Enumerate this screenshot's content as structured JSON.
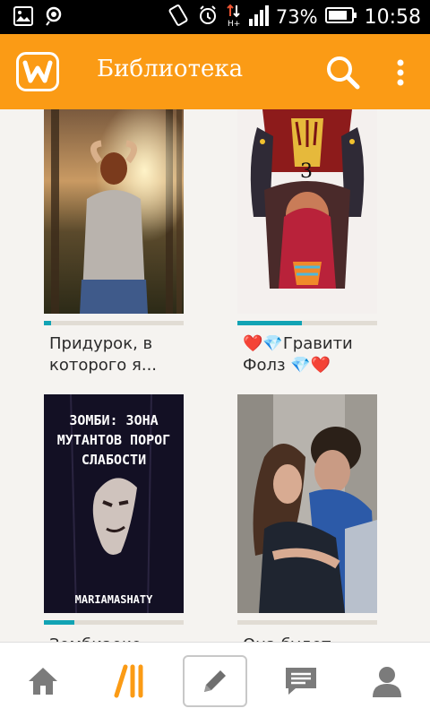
{
  "status_bar": {
    "left_icons": [
      "gallery-icon",
      "mic-icon"
    ],
    "right_icons": [
      "vibrate-icon",
      "alarm-icon",
      "data-arrows-icon",
      "signal-icon",
      "battery-icon"
    ],
    "battery_percent": "73%",
    "time": "10:58"
  },
  "app_bar": {
    "logo_icon": "wattpad-logo",
    "title": "Библиотека",
    "search_icon": "search-icon",
    "menu_icon": "more-vert-icon",
    "color": "#fb9b15"
  },
  "books": [
    {
      "title": "Придурок, в которого я...",
      "progress": 0.05
    },
    {
      "title": "❤️💎Гравити Фолз 💎❤️",
      "progress": 0.46
    },
    {
      "title": "Зомбиаоко...",
      "progress": 0.22,
      "cover_text": {
        "heading": "ЗОМБИ: ЗОНА МУТАНТОВ ПОРОГ СЛАБОСТИ",
        "author": "MARIAMASHATY"
      }
    },
    {
      "title": "Она будет...",
      "progress": 0.0
    }
  ],
  "bottom_nav": {
    "items": [
      "home-icon",
      "library-icon",
      "write-icon",
      "messages-icon",
      "profile-icon"
    ],
    "active": "library-icon"
  },
  "colors": {
    "accent": "#fb9b15",
    "progress": "#12a3b4"
  }
}
